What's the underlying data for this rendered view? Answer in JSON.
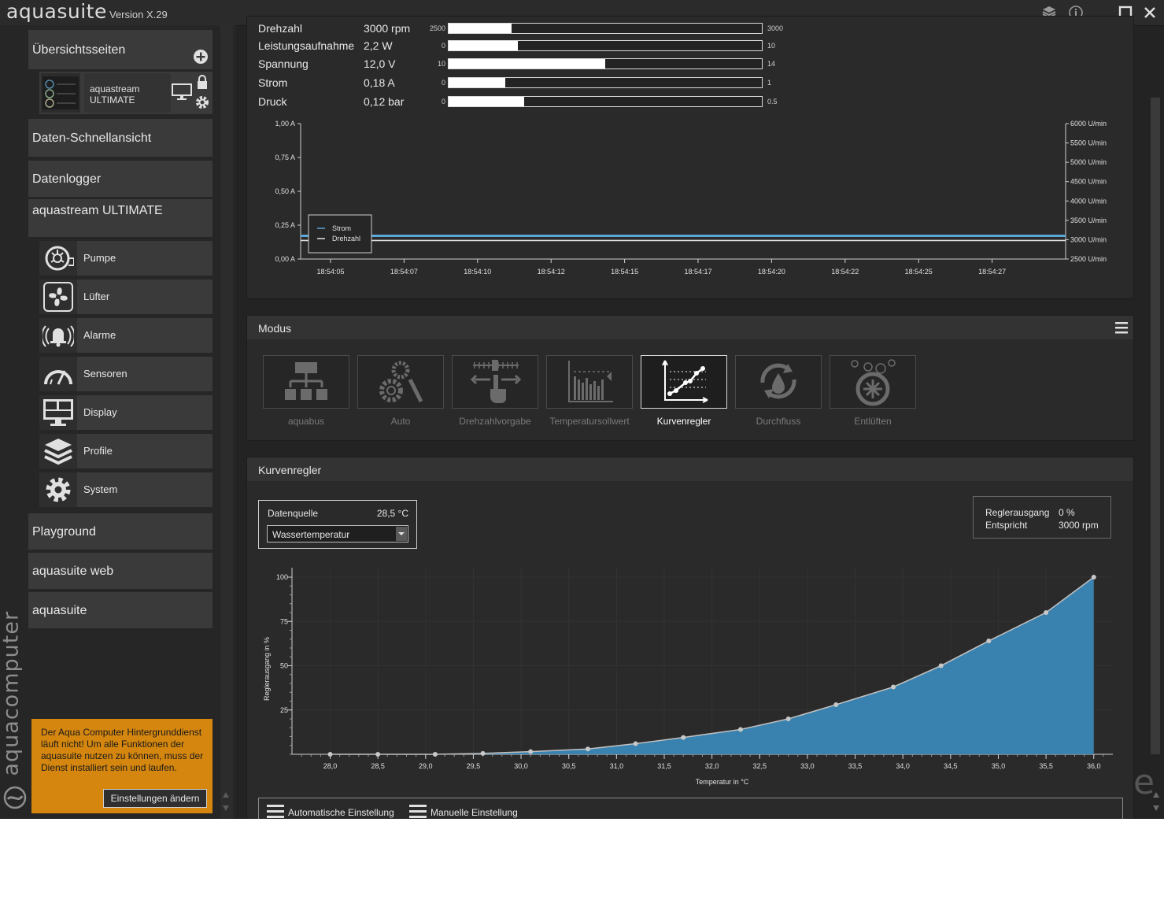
{
  "app": {
    "title": "aquasuite",
    "version": "Version X.29",
    "brand_vertical": "aquacomputer"
  },
  "sidebar": {
    "overview": "Übersichtsseiten",
    "device": {
      "name_line1": "aquastream",
      "name_line2": "ULTIMATE"
    },
    "quick_view": "Daten-Schnellansicht",
    "datalogger": "Datenlogger",
    "device_section": "aquastream ULTIMATE",
    "items": [
      {
        "label": "Pumpe",
        "icon": "pump-icon"
      },
      {
        "label": "Lüfter",
        "icon": "fan-icon"
      },
      {
        "label": "Alarme",
        "icon": "alarm-icon"
      },
      {
        "label": "Sensoren",
        "icon": "gauge-icon"
      },
      {
        "label": "Display",
        "icon": "display-icon"
      },
      {
        "label": "Profile",
        "icon": "layers-icon"
      },
      {
        "label": "System",
        "icon": "gear-icon"
      }
    ],
    "playground": "Playground",
    "web": "aquasuite web",
    "aquasuite": "aquasuite"
  },
  "warning": {
    "text": "Der Aqua Computer Hintergrunddienst läuft nicht! Um alle Funktionen der aquasuite nutzen zu können, muss der Dienst installiert sein und laufen.",
    "button": "Einstellungen ändern"
  },
  "stats": [
    {
      "label": "Drehzahl",
      "value": "3000 rpm",
      "min": "2500",
      "max": "3000",
      "fill": 0.2
    },
    {
      "label": "Leistungsaufnahme",
      "value": "2,2 W",
      "min": "0",
      "max": "10",
      "fill": 0.22
    },
    {
      "label": "Spannung",
      "value": "12,0 V",
      "min": "10",
      "max": "14",
      "fill": 0.5
    },
    {
      "label": "Strom",
      "value": "0,18 A",
      "min": "0",
      "max": "1",
      "fill": 0.18
    },
    {
      "label": "Druck",
      "value": "0,12 bar",
      "min": "0",
      "max": "0.5",
      "fill": 0.24
    }
  ],
  "time_chart": {
    "left_ticks": [
      "1,00 A",
      "0,75 A",
      "0,50 A",
      "0,25 A",
      "0,00 A"
    ],
    "right_ticks": [
      "6000 U/min",
      "5500 U/min",
      "5000 U/min",
      "4500 U/min",
      "4000 U/min",
      "3500 U/min",
      "3000 U/min",
      "2500 U/min"
    ],
    "x_ticks": [
      "18:54:05",
      "18:54:07",
      "18:54:10",
      "18:54:12",
      "18:54:15",
      "18:54:17",
      "18:54:20",
      "18:54:22",
      "18:54:25",
      "18:54:27"
    ],
    "legend": [
      "Strom",
      "Drehzahl"
    ],
    "strom_value": 0.18,
    "drehzahl_value": 3000,
    "colors": {
      "strom": "#5aa7d6",
      "drehzahl": "#e0e0e0"
    }
  },
  "modus": {
    "title": "Modus",
    "buttons": [
      {
        "label": "aquabus",
        "icon": "network-icon",
        "active": false
      },
      {
        "label": "Auto",
        "icon": "auto-gears-icon",
        "active": false
      },
      {
        "label": "Drehzahlvorgabe",
        "icon": "speed-set-icon",
        "active": false
      },
      {
        "label": "Temperatursollwert",
        "icon": "temperature-target-icon",
        "active": false
      },
      {
        "label": "Kurvenregler",
        "icon": "curve-icon",
        "active": true
      },
      {
        "label": "Durchfluss",
        "icon": "flow-icon",
        "active": false
      },
      {
        "label": "Entlüften",
        "icon": "bleed-icon",
        "active": false
      }
    ]
  },
  "kurven": {
    "title": "Kurvenregler",
    "source_label": "Datenquelle",
    "source_value": "28,5 °C",
    "source_select": "Wassertemperatur",
    "output_label": "Reglerausgang",
    "output_value": "0 %",
    "equiv_label": "Entspricht",
    "equiv_value": "3000 rpm",
    "auto_setting": "Automatische Einstellung",
    "manual_setting": "Manuelle Einstellung"
  },
  "chart_data": {
    "type": "area",
    "xlabel": "Temperatur in °C",
    "ylabel": "Reglerausgang in %",
    "xlim": [
      27.6,
      36.2
    ],
    "ylim": [
      0,
      100
    ],
    "x_ticks": [
      "28,0",
      "28,5",
      "29,0",
      "29,5",
      "30,0",
      "30,5",
      "31,0",
      "31,5",
      "32,0",
      "32,5",
      "33,0",
      "33,5",
      "34,0",
      "34,5",
      "35,0",
      "35,5",
      "36,0"
    ],
    "y_ticks": [
      "25",
      "50",
      "75",
      "100"
    ],
    "x": [
      28.0,
      28.5,
      29.1,
      29.6,
      30.1,
      30.7,
      31.2,
      31.7,
      32.3,
      32.8,
      33.3,
      33.9,
      34.4,
      34.9,
      35.5,
      36.0
    ],
    "y": [
      0,
      0,
      0,
      0.5,
      1.5,
      3,
      6,
      9.5,
      14,
      20,
      28,
      38,
      50,
      64,
      80,
      100
    ],
    "fill_color": "#3a86b5",
    "line_color": "#bfbfbf"
  },
  "taskbar_glyph": "e"
}
